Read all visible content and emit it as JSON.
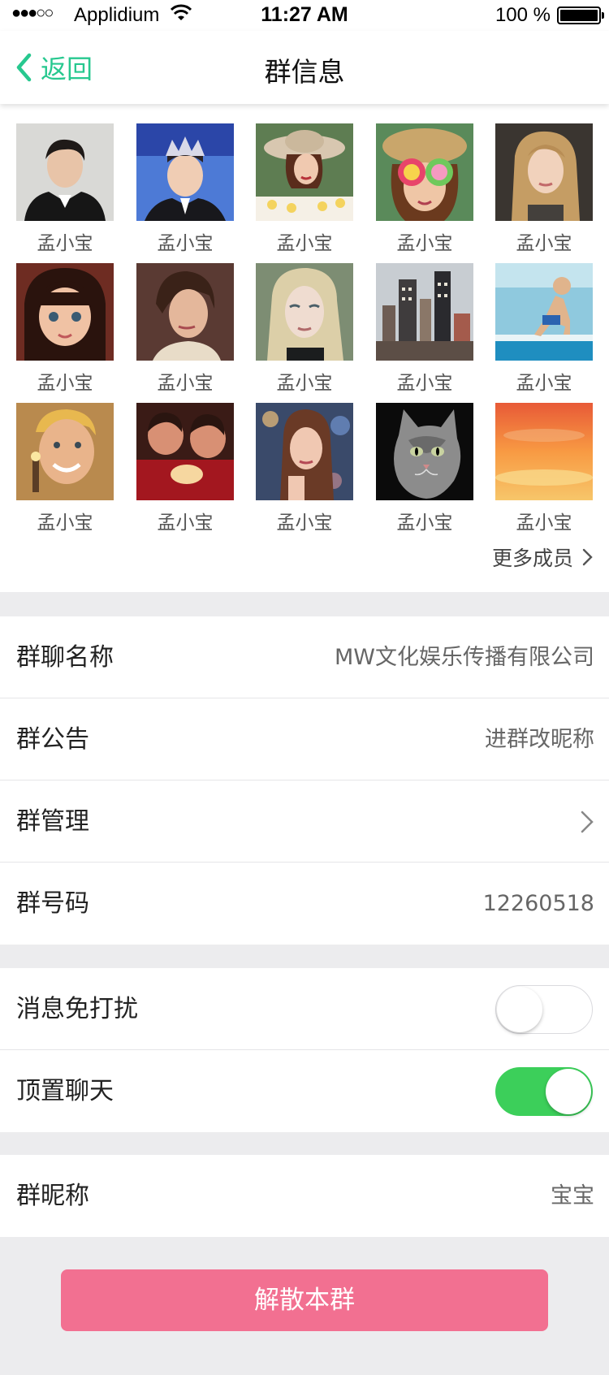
{
  "status_bar": {
    "signal": "●●●○○",
    "carrier": "Applidium",
    "time": "11:27 AM",
    "battery_text": "100 %"
  },
  "nav": {
    "back_label": "返回",
    "title": "群信息"
  },
  "members": {
    "items": [
      {
        "name": "孟小宝",
        "photo": "avatar-boy-suit"
      },
      {
        "name": "孟小宝",
        "photo": "avatar-boy-crown"
      },
      {
        "name": "孟小宝",
        "photo": "avatar-woman-hat"
      },
      {
        "name": "孟小宝",
        "photo": "avatar-girl-lollipops"
      },
      {
        "name": "孟小宝",
        "photo": "avatar-blonde-woman"
      },
      {
        "name": "孟小宝",
        "photo": "avatar-girl-bangs"
      },
      {
        "name": "孟小宝",
        "photo": "avatar-woman-shorthair"
      },
      {
        "name": "孟小宝",
        "photo": "avatar-blonde-portrait"
      },
      {
        "name": "孟小宝",
        "photo": "avatar-city-skyline"
      },
      {
        "name": "孟小宝",
        "photo": "avatar-boy-pool"
      },
      {
        "name": "孟小宝",
        "photo": "avatar-boy-smiling"
      },
      {
        "name": "孟小宝",
        "photo": "avatar-kids-red"
      },
      {
        "name": "孟小宝",
        "photo": "avatar-woman-bokeh"
      },
      {
        "name": "孟小宝",
        "photo": "avatar-cat"
      },
      {
        "name": "孟小宝",
        "photo": "avatar-sunset"
      }
    ],
    "more_label": "更多成员"
  },
  "group_info": {
    "name_label": "群聊名称",
    "name_value": "MW文化娱乐传播有限公司",
    "notice_label": "群公告",
    "notice_value": "进群改昵称",
    "manage_label": "群管理",
    "number_label": "群号码",
    "number_value": "12260518"
  },
  "settings": {
    "mute_label": "消息免打扰",
    "mute_on": false,
    "pin_label": "顶置聊天",
    "pin_on": true
  },
  "nickname": {
    "label": "群昵称",
    "value": "宝宝"
  },
  "dissolve_label": "解散本群",
  "colors": {
    "accent": "#27c88f",
    "toggle_on": "#3ccf5a",
    "danger": "#f27091",
    "background": "#ececee"
  }
}
